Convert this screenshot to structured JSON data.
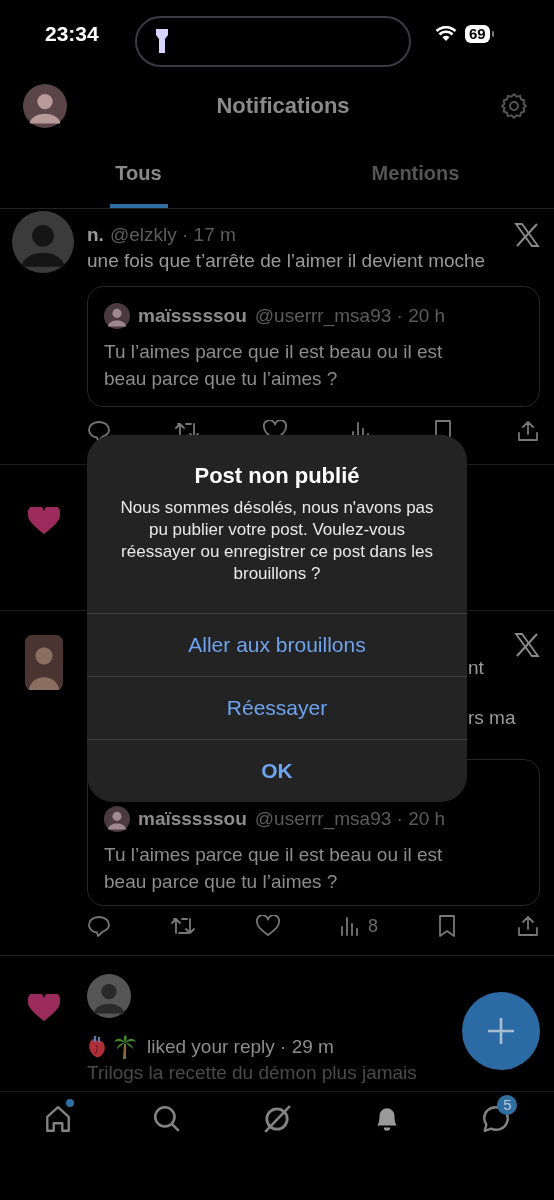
{
  "status_bar": {
    "time": "23:34",
    "battery": "69"
  },
  "header": {
    "title": "Notifications"
  },
  "tabs": [
    {
      "label": "Tous",
      "selected": true
    },
    {
      "label": "Mentions",
      "selected": false
    }
  ],
  "feed": [
    {
      "kind": "post",
      "name": "n.",
      "handle": "@elzkly ·",
      "time": "17 m",
      "text": "une fois que t’arrête de l’aimer il devient moche",
      "quote": {
        "name": "maïsssssou",
        "handle": "@userrr_msa93 ·",
        "time": "20 h",
        "text": "Tu l’aimes parce que il est beau ou il est beau parce que tu l’aimes ?"
      }
    },
    {
      "kind": "like"
    },
    {
      "kind": "post",
      "fragments": [
        "nt",
        "rs ma"
      ],
      "views": "8",
      "quote": {
        "name": "maïsssssou",
        "handle": "@userrr_msa93 ·",
        "time": "20 h",
        "text": "Tu l’aimes parce que il est beau ou il est beau parce que tu l’aimes ?"
      }
    },
    {
      "kind": "like",
      "action": "liked your reply ·",
      "time": "29 m",
      "text": "Trilogs la recette du démon plus jamais"
    }
  ],
  "dialog": {
    "title": "Post non publié",
    "message": "Nous sommes désolés, nous n'avons pas pu publier votre post. Voulez-vous réessayer ou enregistrer ce post dans les brouillons ?",
    "buttons": [
      {
        "label": "Aller aux brouillons",
        "bold": false
      },
      {
        "label": "Réessayer",
        "bold": false
      },
      {
        "label": "OK",
        "bold": true
      }
    ]
  },
  "tab_bar": [
    {
      "kind": "home",
      "selected": false,
      "dot": true
    },
    {
      "kind": "search",
      "selected": false,
      "dot": false
    },
    {
      "kind": "grok",
      "selected": false,
      "dot": false
    },
    {
      "kind": "notifications",
      "selected": true,
      "dot": false
    },
    {
      "kind": "messages",
      "selected": false,
      "dot": false,
      "badge": "5"
    }
  ]
}
